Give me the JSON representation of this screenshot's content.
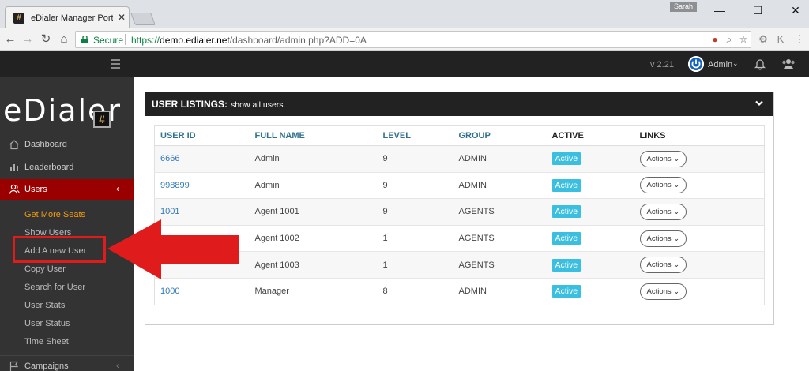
{
  "browser": {
    "tab_title": "eDialer Manager Portal |",
    "tab_favicon": "#",
    "profile": "Sarah",
    "secure_label": "Secure",
    "url_scheme": "https://",
    "url_host": "demo.edialer.net",
    "url_path": "/dashboard/admin.php?ADD=0A",
    "icons": {
      "back": "back-arrow-icon",
      "forward": "forward-arrow-icon",
      "reload": "reload-icon",
      "home": "home-icon",
      "lock": "lock-icon",
      "zoom": "zoom-icon",
      "bookmark": "star-icon",
      "menu": "kebab-menu-icon"
    }
  },
  "app_header": {
    "version": "v 2.21",
    "user_label": "Admin"
  },
  "sidebar": {
    "brand_text": "eDialer",
    "brand_badge": "#",
    "items": [
      {
        "label": "Dashboard",
        "icon": "home-icon"
      },
      {
        "label": "Leaderboard",
        "icon": "bar-chart-icon"
      },
      {
        "label": "Users",
        "icon": "users-icon",
        "active": true
      },
      {
        "label": "Campaigns",
        "icon": "flag-icon"
      }
    ],
    "sub_items": [
      {
        "label": "Get More Seats"
      },
      {
        "label": "Show Users"
      },
      {
        "label": "Add A new User"
      },
      {
        "label": "Copy User"
      },
      {
        "label": "Search for User"
      },
      {
        "label": "User Stats"
      },
      {
        "label": "User Status"
      },
      {
        "label": "Time Sheet"
      }
    ]
  },
  "panel": {
    "title": "USER LISTINGS:",
    "subtitle": "show all users",
    "columns": [
      "USER ID",
      "FULL NAME",
      "LEVEL",
      "GROUP",
      "ACTIVE",
      "LINKS"
    ],
    "rows": [
      {
        "user_id": "6666",
        "full_name": "Admin",
        "level": "9",
        "group": "ADMIN",
        "active": "Active",
        "links": "Actions"
      },
      {
        "user_id": "998899",
        "full_name": "Admin",
        "level": "9",
        "group": "ADMIN",
        "active": "Active",
        "links": "Actions"
      },
      {
        "user_id": "1001",
        "full_name": "Agent 1001",
        "level": "9",
        "group": "AGENTS",
        "active": "Active",
        "links": "Actions"
      },
      {
        "user_id": "",
        "full_name": "Agent 1002",
        "level": "1",
        "group": "AGENTS",
        "active": "Active",
        "links": "Actions"
      },
      {
        "user_id": "",
        "full_name": "Agent 1003",
        "level": "1",
        "group": "AGENTS",
        "active": "Active",
        "links": "Actions"
      },
      {
        "user_id": "1000",
        "full_name": "Manager",
        "level": "8",
        "group": "ADMIN",
        "active": "Active",
        "links": "Actions"
      }
    ]
  },
  "colors": {
    "sidebar_bg": "#333333",
    "active_item": "#9b0000",
    "highlight_text": "#f39c12",
    "badge": "#3bbfe0",
    "annotation": "#e01b1b"
  }
}
